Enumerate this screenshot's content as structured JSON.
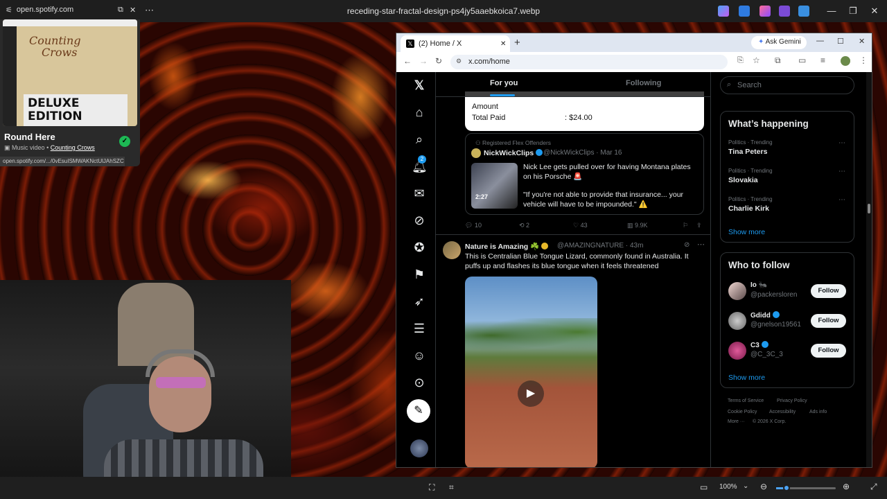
{
  "viewer": {
    "title": "receding-star-fractal-design-ps4jy5aaebkoica7.webp",
    "zoom": "100%"
  },
  "spotify": {
    "url_host": "open.spotify.com",
    "album_lines": [
      "Counting",
      "Crows"
    ],
    "deluxe_lines": [
      "DELUXE",
      "EDITION"
    ],
    "track": "Round Here",
    "kind": "Music video",
    "artist": "Counting Crows",
    "status_url": "open.spotify.com/.../0vEsuISMWAKNctUlJAhSZC"
  },
  "browser": {
    "tab_title": "(2) Home / X",
    "ask_gemini": "Ask Gemini",
    "url": "x.com/home",
    "notification_count": "2"
  },
  "feed": {
    "tabs": [
      "For you",
      "Following"
    ],
    "receipt": {
      "amount_label": "Amount",
      "total_label": "Total Paid",
      "total_value": ": $24.00"
    },
    "quote": {
      "context": "Registered Flex Offenders",
      "author": "NickWickClips",
      "handle_time": "@NickWickClips · Mar 16",
      "text1": "Nick Lee gets pulled over for having Montana plates on his Porsche 🚨",
      "text2": "\"If you're not able to provide that insurance... your vehicle will have to be impounded.\" ⚠️",
      "duration": "2:27"
    },
    "actions": {
      "replies": "10",
      "reposts": "2",
      "likes": "43",
      "views": "9.9K"
    },
    "tweet": {
      "author": "Nature is Amazing ☘️",
      "handle_time": "@AMAZINGNATURE · 43m",
      "text": "This is Centralian Blue Tongue Lizard, commonly found in Australia. It puffs up and flashes its blue tongue when it feels threatened"
    }
  },
  "sidebar": {
    "search_placeholder": "Search",
    "happening_title": "What’s happening",
    "trends": [
      {
        "category": "Politics · Trending",
        "name": "Tina Peters"
      },
      {
        "category": "Politics · Trending",
        "name": "Slovakia"
      },
      {
        "category": "Politics · Trending",
        "name": "Charlie Kirk"
      }
    ],
    "show_more": "Show more",
    "who_title": "Who to follow",
    "who": [
      {
        "name": "Io 🐜",
        "handle": "@packersloren",
        "button": "Follow"
      },
      {
        "name": "Gdidd",
        "handle": "@gnelson19561",
        "button": "Follow"
      },
      {
        "name": "C3",
        "handle": "@C_3C_3",
        "button": "Follow"
      }
    ],
    "footer": [
      "Terms of Service",
      "Privacy Policy",
      "Cookie Policy",
      "Accessibility",
      "Ads info",
      "More ···",
      "© 2026 X Corp."
    ]
  },
  "colors": {
    "x_blue": "#1d9bf0",
    "spotify_green": "#1db954",
    "browser_tabbar": "#dfe6f1"
  }
}
